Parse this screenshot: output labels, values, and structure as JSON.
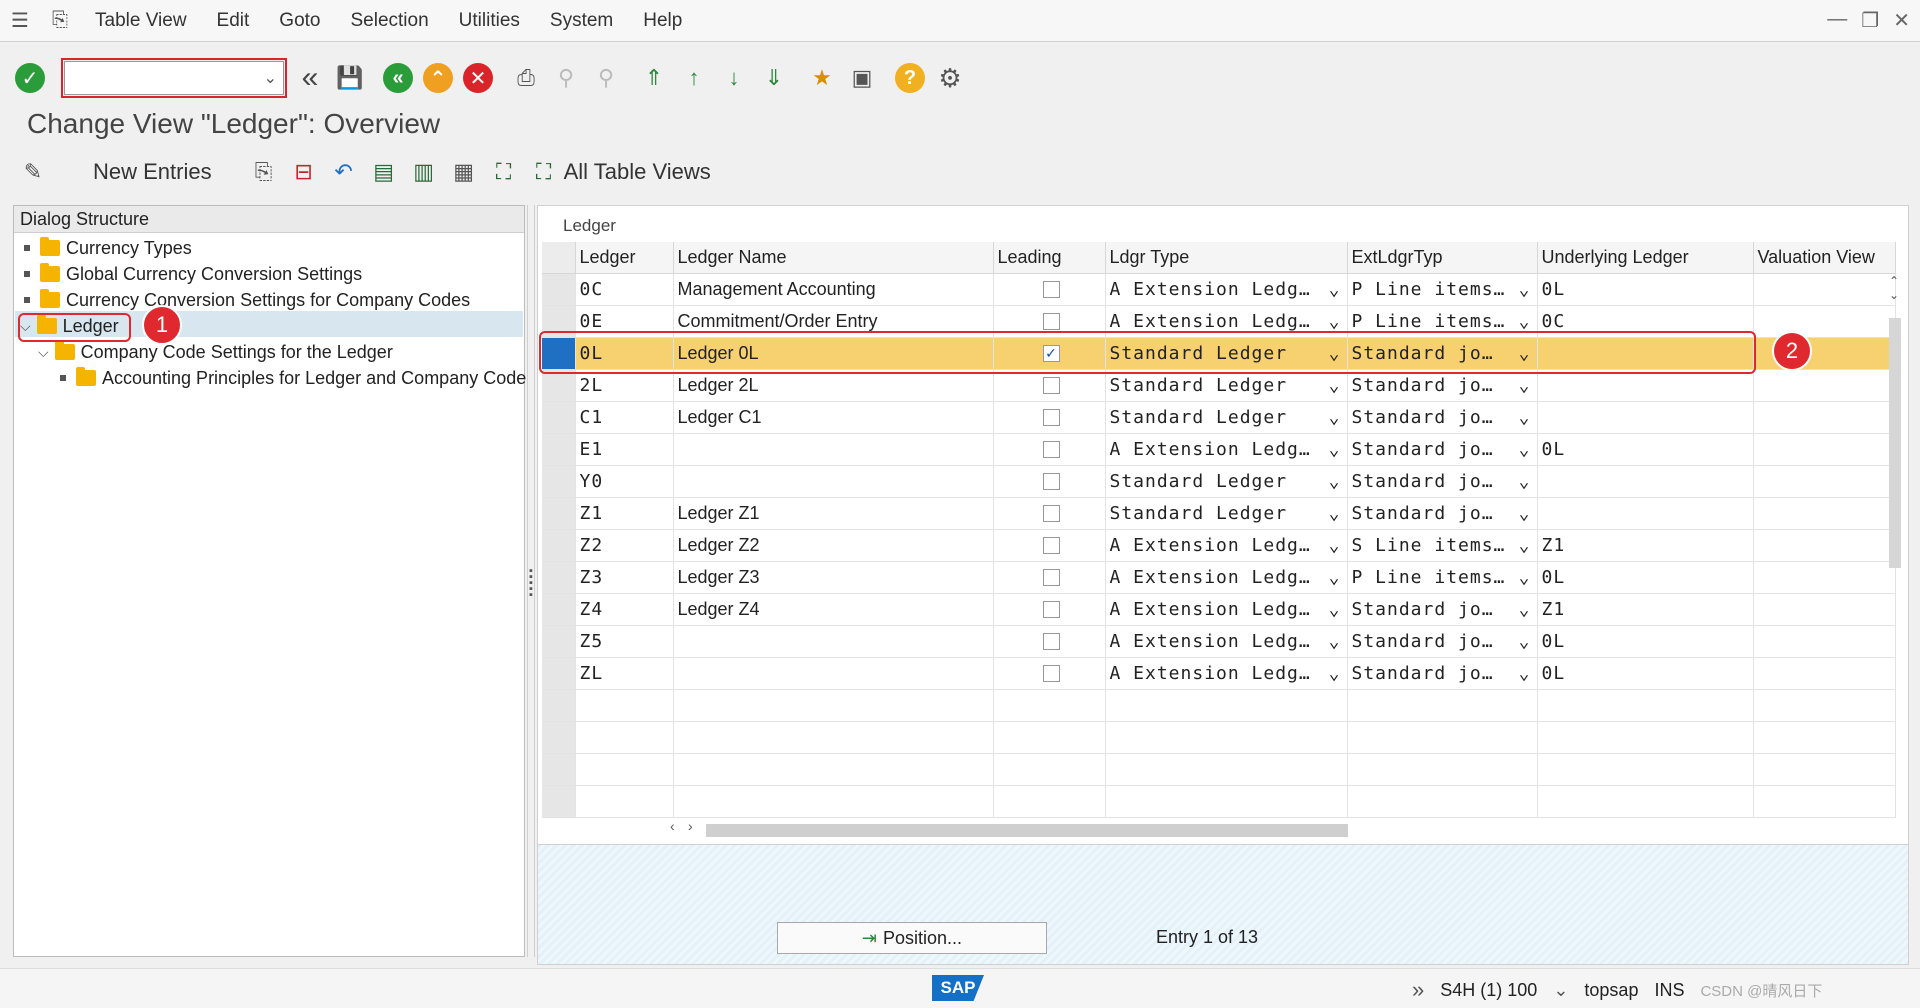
{
  "menubar": {
    "items": [
      "Table View",
      "Edit",
      "Goto",
      "Selection",
      "Utilities",
      "System",
      "Help"
    ]
  },
  "page_title": "Change View \"Ledger\": Overview",
  "app_toolbar": {
    "new_entries": "New Entries",
    "all_table_views": "All Table Views"
  },
  "dialog_structure": {
    "header": "Dialog Structure",
    "items": [
      {
        "label": "Currency Types"
      },
      {
        "label": "Global Currency Conversion Settings"
      },
      {
        "label": "Currency Conversion Settings for Company Codes"
      },
      {
        "label": "Ledger"
      },
      {
        "label": "Company Code Settings for the Ledger"
      },
      {
        "label": "Accounting Principles for Ledger and Company Code"
      }
    ]
  },
  "table": {
    "caption": "Ledger",
    "columns": [
      "Ledger",
      "Ledger Name",
      "Leading",
      "Ldgr Type",
      "ExtLdgrTyp",
      "Underlying Ledger",
      "Valuation View"
    ],
    "rows": [
      {
        "ledger": "0C",
        "name": "Management Accounting",
        "leading": false,
        "type": "A Extension Ledg…",
        "ext": "P Line items…",
        "under": "0L"
      },
      {
        "ledger": "0E",
        "name": "Commitment/Order Entry",
        "leading": false,
        "type": "A Extension Ledg…",
        "ext": "P Line items…",
        "under": "0C"
      },
      {
        "ledger": "0L",
        "name": "Ledger 0L",
        "leading": true,
        "type": " Standard Ledger",
        "ext": " Standard jo…",
        "under": ""
      },
      {
        "ledger": "2L",
        "name": "Ledger 2L",
        "leading": false,
        "type": " Standard Ledger",
        "ext": " Standard jo…",
        "under": ""
      },
      {
        "ledger": "C1",
        "name": "Ledger C1",
        "leading": false,
        "type": " Standard Ledger",
        "ext": " Standard jo…",
        "under": ""
      },
      {
        "ledger": "E1",
        "name": "",
        "leading": false,
        "type": "A Extension Ledg…",
        "ext": " Standard jo…",
        "under": "0L"
      },
      {
        "ledger": "Y0",
        "name": "",
        "leading": false,
        "type": " Standard Ledger",
        "ext": " Standard jo…",
        "under": ""
      },
      {
        "ledger": "Z1",
        "name": "Ledger Z1",
        "leading": false,
        "type": " Standard Ledger",
        "ext": " Standard jo…",
        "under": ""
      },
      {
        "ledger": "Z2",
        "name": "Ledger Z2",
        "leading": false,
        "type": "A Extension Ledg…",
        "ext": "S Line items…",
        "under": "Z1"
      },
      {
        "ledger": "Z3",
        "name": "Ledger Z3",
        "leading": false,
        "type": "A Extension Ledg…",
        "ext": "P Line items…",
        "under": "0L"
      },
      {
        "ledger": "Z4",
        "name": "Ledger Z4",
        "leading": false,
        "type": "A Extension Ledg…",
        "ext": " Standard jo…",
        "under": "Z1"
      },
      {
        "ledger": "Z5",
        "name": "",
        "leading": false,
        "type": "A Extension Ledg…",
        "ext": " Standard jo…",
        "under": "0L"
      },
      {
        "ledger": "ZL",
        "name": "",
        "leading": false,
        "type": "A Extension Ledg…",
        "ext": " Standard jo…",
        "under": "0L"
      }
    ]
  },
  "position_button": "Position...",
  "entry_info": "Entry 1 of 13",
  "status": {
    "system": "S4H (1) 100",
    "host": "topsap",
    "mode": "INS",
    "watermark": "CSDN @晴风日下"
  },
  "annotations": {
    "badge1": "1",
    "badge2": "2"
  },
  "colors": {
    "highlight_row": "#f7d06f",
    "annotation_red": "#e0292f",
    "accent_blue": "#1f6fc3"
  }
}
